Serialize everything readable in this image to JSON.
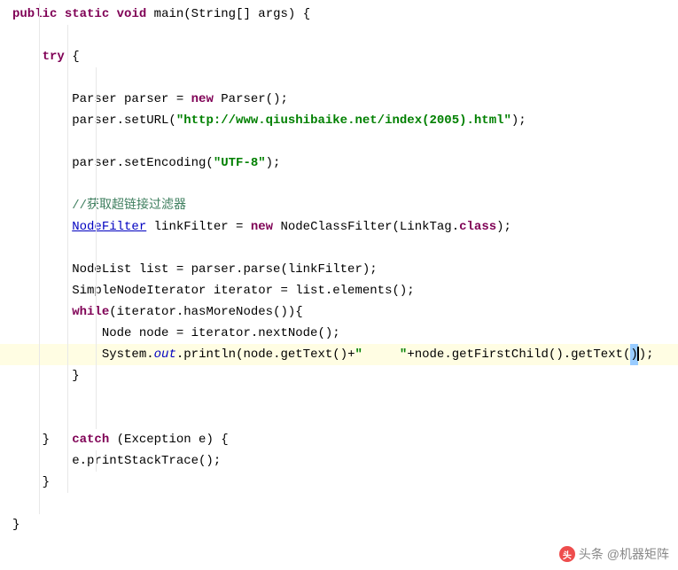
{
  "code": {
    "l1_kw1": "public",
    "l1_kw2": "static",
    "l1_kw3": "void",
    "l1_rest": " main(String[] args) {",
    "l3_indent": "    ",
    "l3_kw": "try",
    "l3_rest": " {",
    "l5_indent": "        Parser parser = ",
    "l5_kw": "new",
    "l5_rest": " Parser();",
    "l6_indent": "        parser.setURL(",
    "l6_str": "\"http://www.qiushibaike.net/index(2005).html\"",
    "l6_rest": ");",
    "l8_indent": "        parser.setEncoding(",
    "l8_str": "\"UTF-8\"",
    "l8_rest": ");",
    "l10_indent": "        ",
    "l10_comment": "//获取超链接过滤器",
    "l11_indent": "        ",
    "l11_type": "NodeFilter",
    "l11_mid": " linkFilter = ",
    "l11_kw": "new",
    "l11_mid2": " NodeClassFilter(LinkTag.",
    "l11_kw2": "class",
    "l11_rest": ");",
    "l13_text": "        NodeList list = parser.parse(linkFilter);",
    "l14_text": "        SimpleNodeIterator iterator = list.elements();",
    "l15_indent": "        ",
    "l15_kw": "while",
    "l15_rest": "(iterator.hasMoreNodes()){",
    "l16_text": "            Node node = iterator.nextNode();",
    "l17_indent": "            System.",
    "l17_field": "out",
    "l17_mid": ".println(node.getText()+",
    "l17_str1": "\"     \"",
    "l17_mid2": "+node.getFirstChild().getText(",
    "l17_cursor": ")",
    "l17_rest": ");",
    "l18_text": "        }",
    "l21_indent": "    }   ",
    "l21_kw": "catch",
    "l21_rest": " (Exception e) {",
    "l22_text": "        e.printStackTrace();",
    "l23_text": "    }",
    "l25_text": "}"
  },
  "watermark": {
    "text": "头条 @机器矩阵"
  }
}
